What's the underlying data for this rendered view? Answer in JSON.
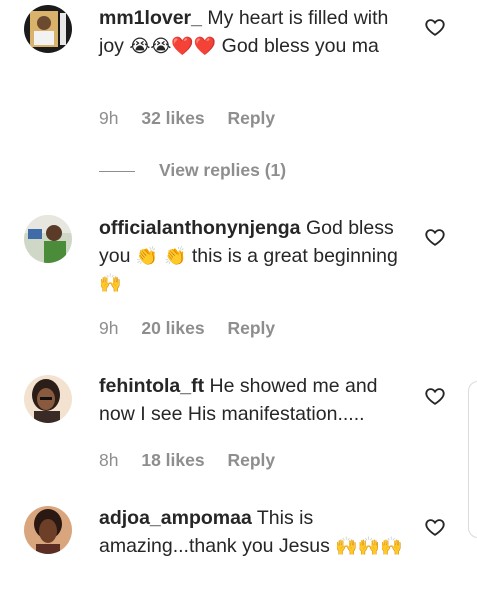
{
  "comments": [
    {
      "username": "mm1lover_",
      "text_before": "My heart is filled with joy",
      "emoji": "😭😭❤️❤️",
      "text_after": "God bless you ma",
      "time": "9h",
      "likes": "32 likes",
      "reply": "Reply",
      "view_replies": "View replies (1)"
    },
    {
      "username": "officialanthonynjenga",
      "text_before": "God bless you",
      "emoji1": "👏 👏",
      "text_middle": "this is a great beginning",
      "emoji2": "🙌",
      "time": "9h",
      "likes": "20 likes",
      "reply": "Reply"
    },
    {
      "username": "fehintola_ft",
      "text": "He showed me and now I see His manifestation.....",
      "time": "8h",
      "likes": "18 likes",
      "reply": "Reply"
    },
    {
      "username": "adjoa_ampomaa",
      "text": "This is amazing...thank you Jesus",
      "emoji": "🙌🙌🙌"
    }
  ],
  "colors": {
    "text": "#262626",
    "meta": "#8e8e8e"
  },
  "icons": {
    "like": "heart-outline-icon"
  }
}
